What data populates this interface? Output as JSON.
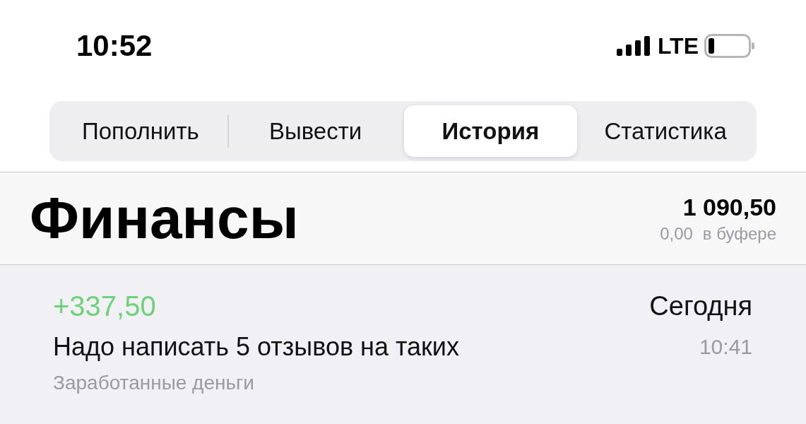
{
  "status_bar": {
    "time": "10:52",
    "network": "LTE"
  },
  "tabs": [
    {
      "label": "Пополнить",
      "selected": false
    },
    {
      "label": "Вывести",
      "selected": false
    },
    {
      "label": "История",
      "selected": true
    },
    {
      "label": "Статистика",
      "selected": false
    }
  ],
  "header": {
    "title": "Финансы",
    "balance": "1 090,50",
    "buffer_amount": "0,00",
    "buffer_label": "в буфере"
  },
  "transactions": [
    {
      "amount": "+337,50",
      "kind": "income",
      "date": "Сегодня",
      "description": "Надо написать 5 отзывов на таких",
      "time": "10:41",
      "category": "Заработанные деньги"
    }
  ]
}
